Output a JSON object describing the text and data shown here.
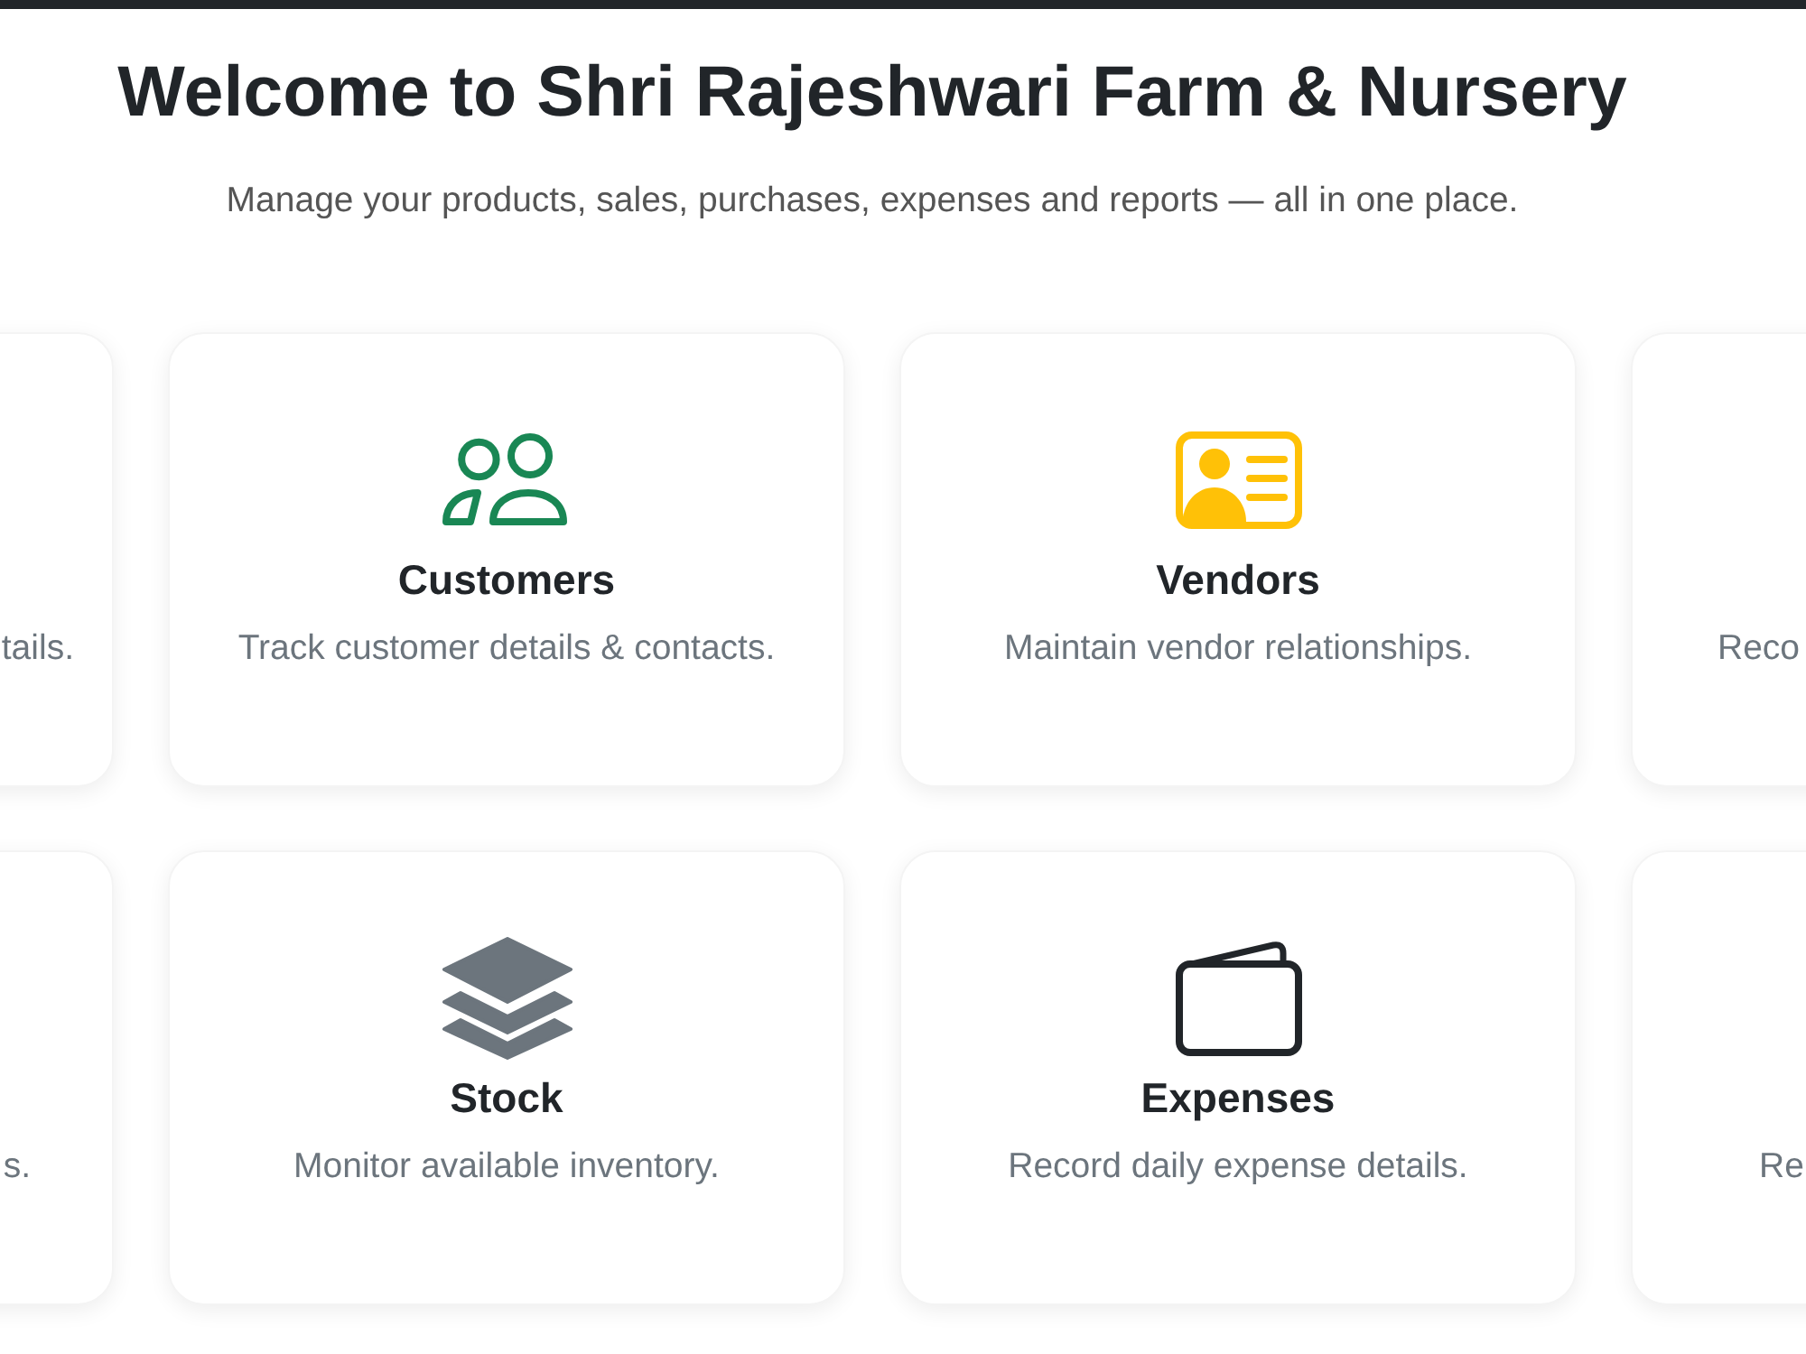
{
  "title": "Welcome to Shri Rajeshwari Farm & Nursery",
  "subtitle": "Manage your products, sales, purchases, expenses and reports — all in one place.",
  "cards": [
    {
      "kind": "cut_left",
      "description": "tails."
    },
    {
      "kind": "full",
      "color": "#198754",
      "title": "Customers",
      "description": "Track customer details & contacts."
    },
    {
      "kind": "full",
      "color": "#ffc107",
      "title": "Vendors",
      "description": "Maintain vendor relationships."
    },
    {
      "kind": "cut_right",
      "description": "Reco"
    },
    {
      "kind": "cut_left",
      "description": "s."
    },
    {
      "kind": "full",
      "color": "#6c757d",
      "title": "Stock",
      "description": "Monitor available inventory."
    },
    {
      "kind": "full",
      "color": "#212529",
      "title": "Expenses",
      "description": "Record daily expense details."
    },
    {
      "kind": "cut_right",
      "description": "Re"
    }
  ]
}
